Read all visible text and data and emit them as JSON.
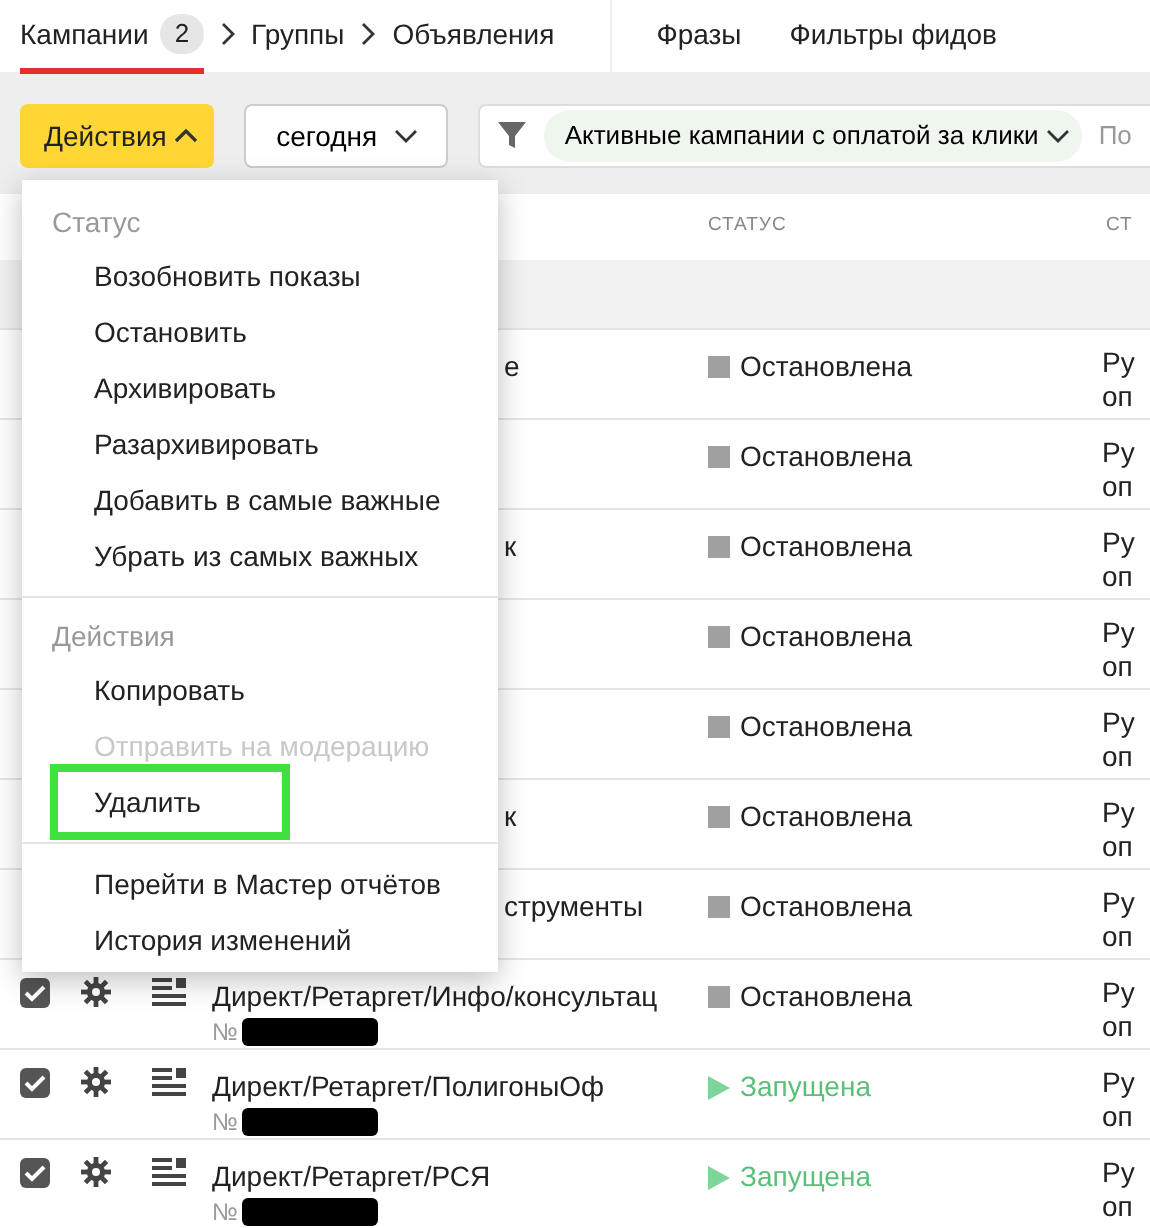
{
  "nav": {
    "tabs": [
      {
        "kind": "crumb",
        "label": "Кампании",
        "badge": "2",
        "selected": true
      },
      {
        "kind": "crumb",
        "label": "Группы",
        "selected": false
      },
      {
        "kind": "crumb",
        "label": "Объявления",
        "selected": false
      },
      {
        "kind": "link",
        "label": "Фразы",
        "selected": false
      },
      {
        "kind": "link",
        "label": "Фильтры фидов",
        "selected": false
      }
    ]
  },
  "toolbar": {
    "actions_button": {
      "label": "Действия",
      "expanded": true
    },
    "period": {
      "label": "сегодня"
    },
    "filter": {
      "chip": "Активные кампании с оплатой за клики",
      "placeholder": "По"
    }
  },
  "menu": {
    "sections": [
      {
        "title": "Статус",
        "items": [
          {
            "label": "Возобновить показы",
            "disabled": false,
            "highlighted": false
          },
          {
            "label": "Остановить",
            "disabled": false,
            "highlighted": false
          },
          {
            "label": "Архивировать",
            "disabled": false,
            "highlighted": false
          },
          {
            "label": "Разархивировать",
            "disabled": false,
            "highlighted": false
          },
          {
            "label": "Добавить в самые важные",
            "disabled": false,
            "highlighted": false
          },
          {
            "label": "Убрать из самых важных",
            "disabled": false,
            "highlighted": false
          }
        ]
      },
      {
        "title": "Действия",
        "items": [
          {
            "label": "Копировать",
            "disabled": false,
            "highlighted": false
          },
          {
            "label": "Отправить на модерацию",
            "disabled": true,
            "highlighted": false
          },
          {
            "label": "Удалить",
            "disabled": false,
            "highlighted": true
          }
        ]
      },
      {
        "items": [
          {
            "label": "Перейти в Мастер отчётов",
            "disabled": false,
            "highlighted": false
          },
          {
            "label": "История изменений",
            "disabled": false,
            "highlighted": false
          }
        ]
      }
    ]
  },
  "table": {
    "columns": [
      {
        "label": "СТАТУС"
      },
      {
        "label": "СТ"
      }
    ],
    "rows": [
      {
        "kind": "covered",
        "name": "е",
        "status": {
          "label": "Остановлена",
          "kind": "stopped"
        },
        "column_3": [
          "Ру",
          "оп"
        ]
      },
      {
        "kind": "covered",
        "status": {
          "label": "Остановлена",
          "kind": "stopped"
        },
        "column_3": [
          "Ру",
          "оп"
        ]
      },
      {
        "kind": "covered",
        "name": "к",
        "status": {
          "label": "Остановлена",
          "kind": "stopped"
        },
        "column_3": [
          "Ру",
          "оп"
        ]
      },
      {
        "kind": "covered",
        "status": {
          "label": "Остановлена",
          "kind": "stopped"
        },
        "column_3": [
          "Ру",
          "оп"
        ]
      },
      {
        "kind": "covered",
        "status": {
          "label": "Остановлена",
          "kind": "stopped"
        },
        "column_3": [
          "Ру",
          "оп"
        ]
      },
      {
        "kind": "covered",
        "name": "к",
        "status": {
          "label": "Остановлена",
          "kind": "stopped"
        },
        "column_3": [
          "Ру",
          "оп"
        ]
      },
      {
        "kind": "covered",
        "name": "струменты",
        "status": {
          "label": "Остановлена",
          "kind": "stopped"
        },
        "column_3": [
          "Ру",
          "оп"
        ]
      },
      {
        "kind": "full",
        "checked": true,
        "name": "Директ/Ретаргет/Инфо/консультац",
        "number": "№",
        "status": {
          "label": "Остановлена",
          "kind": "stopped"
        },
        "column_3": [
          "Ру",
          "оп"
        ]
      },
      {
        "kind": "full",
        "checked": true,
        "name": "Директ/Ретаргет/ПолигоныОф",
        "number": "№",
        "status": {
          "label": "Запущена",
          "kind": "running"
        },
        "column_3": [
          "Ру",
          "оп"
        ]
      },
      {
        "kind": "full",
        "checked": true,
        "name": "Директ/Ретаргет/РСЯ",
        "number": "№",
        "status": {
          "label": "Запущена",
          "kind": "running"
        },
        "column_3": [
          "Ру",
          "оп"
        ]
      }
    ]
  }
}
